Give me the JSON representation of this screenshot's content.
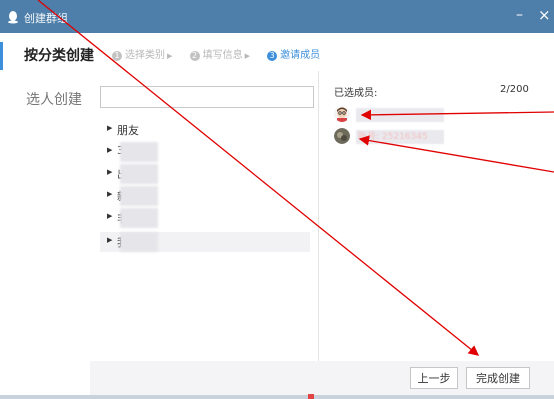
{
  "window": {
    "title": "创建群组",
    "min_glyph": "–",
    "close_glyph": "×"
  },
  "tabs": {
    "category": "按分类创建",
    "select": "选人创建"
  },
  "steps": [
    {
      "num": "1",
      "label": "选择类别"
    },
    {
      "num": "2",
      "label": "填写信息"
    },
    {
      "num": "3",
      "label": "邀请成员"
    }
  ],
  "search": {
    "value": "",
    "placeholder": ""
  },
  "tree": [
    {
      "label": "朋友"
    },
    {
      "label": "3"
    },
    {
      "label": "出"
    },
    {
      "label": "新"
    },
    {
      "label": "非"
    },
    {
      "label": "我"
    }
  ],
  "members": {
    "title": "已选成员:",
    "count": "2/200",
    "items": [
      {
        "name": ""
      },
      {
        "name": "账号: 25216345"
      }
    ]
  },
  "buttons": {
    "prev": "上一步",
    "finish": "完成创建"
  },
  "colors": {
    "titlebar": "#4e7faa",
    "accent": "#3d8fdb",
    "annotation_arrow": "#e00000"
  }
}
